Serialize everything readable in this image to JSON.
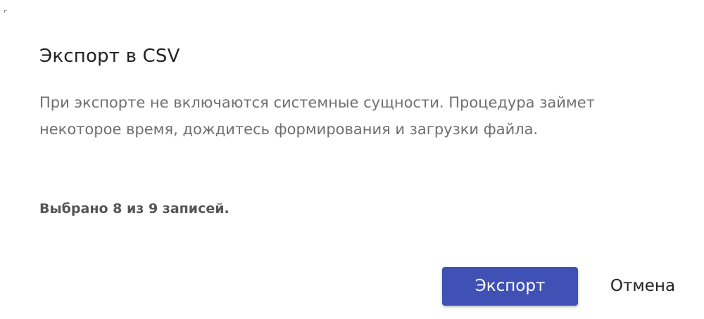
{
  "dialog": {
    "title": "Экспорт в CSV",
    "description": "При экспорте не включаются системные сущности. Процедура займет некоторое время, дождитесь формирования и загрузки файла.",
    "selection_info": "Выбрано 8 из 9 записей.",
    "export_label": "Экспорт",
    "cancel_label": "Отмена"
  },
  "colors": {
    "accent": "#3f51b5",
    "title_text": "#222222",
    "body_text": "#6f6f6f",
    "info_text": "#555555"
  }
}
